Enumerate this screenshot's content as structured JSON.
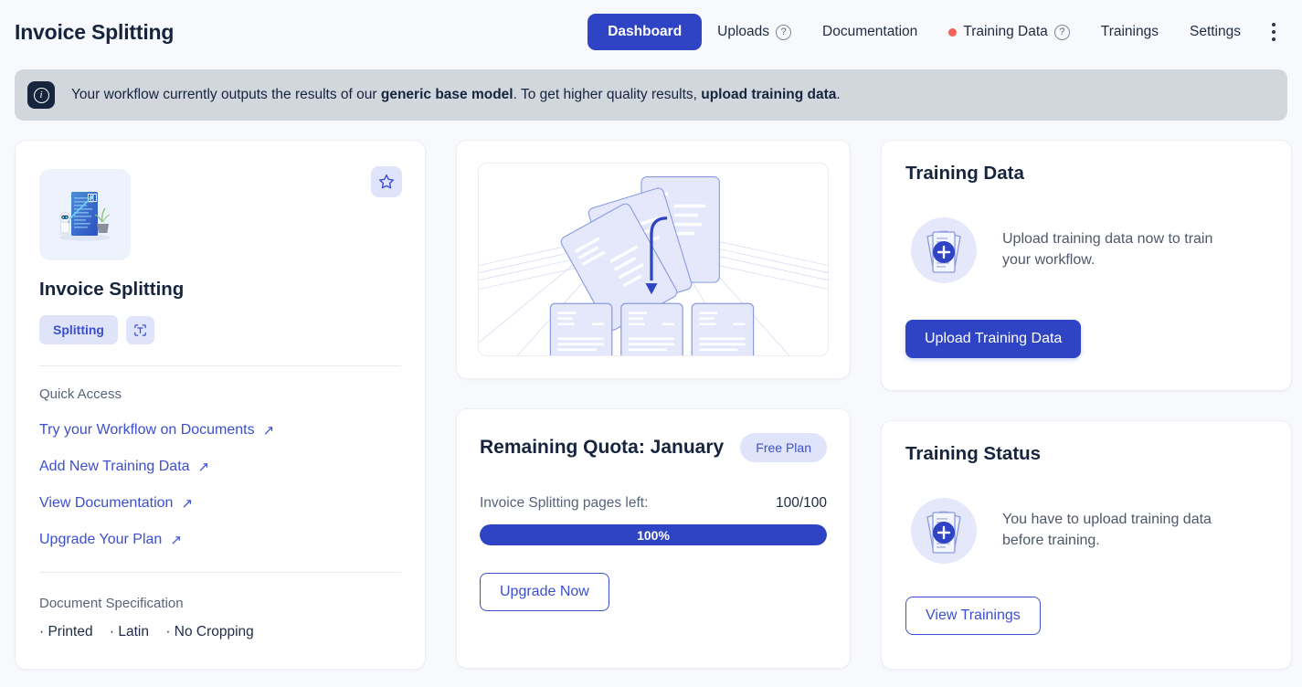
{
  "header": {
    "app_title": "Invoice Splitting",
    "nav": [
      {
        "label": "Dashboard",
        "active": true,
        "help": false,
        "dot": false
      },
      {
        "label": "Uploads",
        "active": false,
        "help": true,
        "dot": false
      },
      {
        "label": "Documentation",
        "active": false,
        "help": false,
        "dot": false
      },
      {
        "label": "Training Data",
        "active": false,
        "help": true,
        "dot": true
      },
      {
        "label": "Trainings",
        "active": false,
        "help": false,
        "dot": false
      },
      {
        "label": "Settings",
        "active": false,
        "help": false,
        "dot": false
      }
    ],
    "menu_icon": "kebab-menu-icon"
  },
  "banner": {
    "icon": "info-icon",
    "text_part_1": "Your workflow currently outputs the results of our ",
    "bold_1": "generic base model",
    "text_part_2": ". To get higher quality results, ",
    "bold_2": "upload training data",
    "text_part_3": "."
  },
  "workflow_card": {
    "thumbnail_icon": "robot-document-illustration",
    "favorite_icon": "star-icon",
    "title": "Invoice Splitting",
    "tag": "Splitting",
    "tag_icon": "text-scan-icon",
    "quick_access_label": "Quick Access",
    "links": [
      {
        "label": "Try your Workflow on Documents",
        "icon": "external-link-icon"
      },
      {
        "label": "Add New Training Data",
        "icon": "external-link-icon"
      },
      {
        "label": "View Documentation",
        "icon": "external-link-icon"
      },
      {
        "label": "Upgrade Your Plan",
        "icon": "external-link-icon"
      }
    ],
    "spec_label": "Document Specification",
    "spec_items": [
      "Printed",
      "Latin",
      "No Cropping"
    ]
  },
  "illustration_card": {
    "icon": "document-splitting-illustration"
  },
  "quota_card": {
    "title": "Remaining Quota: January",
    "plan_badge": "Free Plan",
    "usage_label": "Invoice Splitting pages left:",
    "usage_count": "100/100",
    "progress_label": "100%",
    "progress_percent": 100,
    "upgrade_button": "Upgrade Now"
  },
  "training_data_card": {
    "title": "Training Data",
    "icon": "document-stack-add-icon",
    "text": "Upload training data now to train your workflow.",
    "button": "Upload Training Data"
  },
  "training_status_card": {
    "title": "Training Status",
    "icon": "document-stack-add-icon",
    "text": "You have to upload training data before training.",
    "button": "View Trainings"
  },
  "colors": {
    "accent_blue": "#2f44c4",
    "link_blue": "#3b4fd0",
    "light_blue_bg": "#dfe4fb",
    "banner_bg": "#d2d6dd",
    "banner_icon_bg": "#16243d",
    "status_dot_red": "#f4635a",
    "page_bg": "#f8f9fc"
  }
}
